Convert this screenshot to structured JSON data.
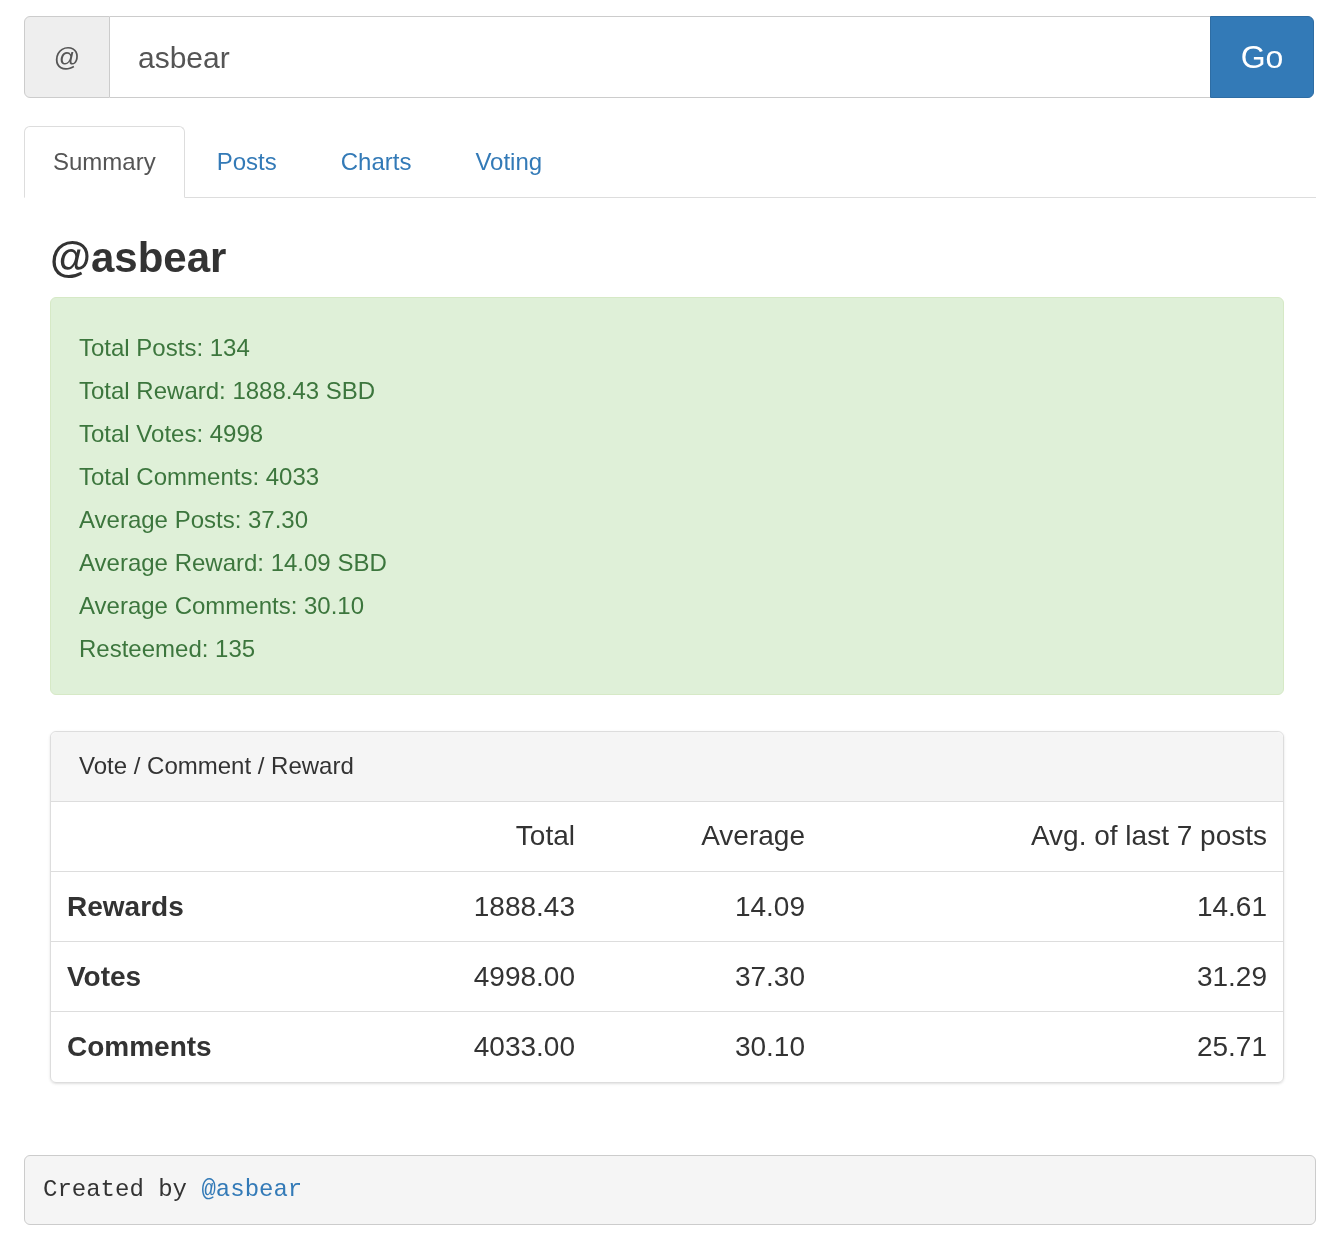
{
  "search": {
    "addon": "@",
    "value": "asbear",
    "button": "Go"
  },
  "tabs": [
    {
      "label": "Summary",
      "selected": true
    },
    {
      "label": "Posts",
      "selected": false
    },
    {
      "label": "Charts",
      "selected": false
    },
    {
      "label": "Voting",
      "selected": false
    }
  ],
  "heading": "@asbear",
  "stats": [
    "Total Posts: 134",
    "Total Reward: 1888.43 SBD",
    "Total Votes: 4998",
    "Total Comments: 4033",
    "Average Posts: 37.30",
    "Average Reward: 14.09 SBD",
    "Average Comments: 30.10",
    "Resteemed: 135"
  ],
  "panel": {
    "title": "Vote / Comment / Reward",
    "columns": [
      "Total",
      "Average",
      "Avg. of last 7 posts"
    ],
    "rows": [
      {
        "label": "Rewards",
        "values": [
          "1888.43",
          "14.09",
          "14.61"
        ]
      },
      {
        "label": "Votes",
        "values": [
          "4998.00",
          "37.30",
          "31.29"
        ]
      },
      {
        "label": "Comments",
        "values": [
          "4033.00",
          "30.10",
          "25.71"
        ]
      }
    ]
  },
  "footer": {
    "text": "Created by",
    "link": "@asbear"
  }
}
